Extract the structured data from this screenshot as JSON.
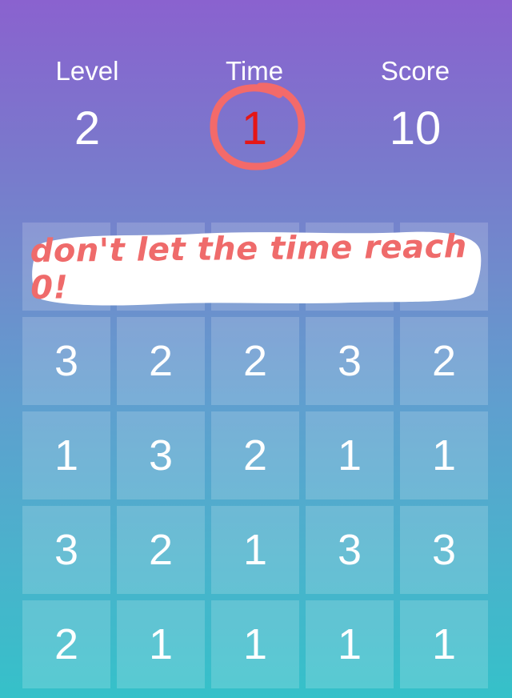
{
  "stats": {
    "level": {
      "label": "Level",
      "value": "2"
    },
    "time": {
      "label": "Time",
      "value": "1"
    },
    "score": {
      "label": "Score",
      "value": "10"
    }
  },
  "tip": "don't let the time reach 0!",
  "grid": {
    "rows": [
      [
        "",
        "",
        "",
        "",
        ""
      ],
      [
        "3",
        "2",
        "2",
        "3",
        "2"
      ],
      [
        "1",
        "3",
        "2",
        "1",
        "1"
      ],
      [
        "3",
        "2",
        "1",
        "3",
        "3"
      ],
      [
        "2",
        "1",
        "1",
        "1",
        "1"
      ]
    ]
  },
  "colors": {
    "gradient_top": "#8a62cf",
    "gradient_bottom": "#35c1c9",
    "time_value": "#e51616",
    "highlight_circle": "#f36a6a",
    "tip_text": "#ef6b6b"
  }
}
